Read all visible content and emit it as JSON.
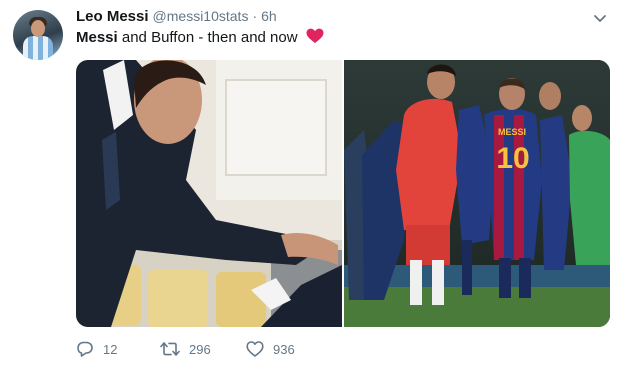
{
  "tweet": {
    "author_name": "Leo Messi",
    "handle": "@messi10stats",
    "separator": "·",
    "time": "6h",
    "text_bold_1": "Messi",
    "text_plain": " and Buffon - then and now",
    "emoji": "red-heart"
  },
  "media": {
    "left_photo": "handshake-photo",
    "right_photo": "match-embrace-photo",
    "jersey_text": "MESSI",
    "jersey_number": "10"
  },
  "actions": {
    "reply_count": "12",
    "retweet_count": "296",
    "like_count": "936"
  },
  "colors": {
    "text": "#14171a",
    "secondary": "#657786",
    "heart": "#e0245e"
  }
}
